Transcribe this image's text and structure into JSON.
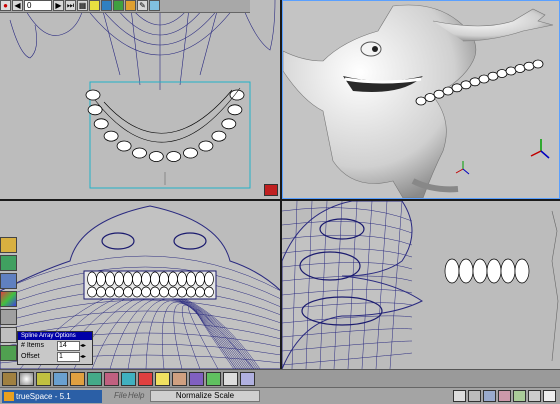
{
  "app": {
    "name": "trueSpace - 5.1",
    "menu_file": "File",
    "menu_help": "Help",
    "status_message": "Normalize Scale"
  },
  "toolbar_top": {
    "frame_value": "0"
  },
  "spline_panel": {
    "title": "Spline Array Options",
    "items_label": "# Items",
    "items_value": "14",
    "offset_label": "Offset",
    "offset_value": "1"
  },
  "icons": {
    "toolbar_top": [
      "record-icon",
      "play-reverse-icon",
      "frame-field",
      "play-forward-icon",
      "end-icon",
      "keyframe-icon",
      "axes-icon",
      "material-icon",
      "paint-icon",
      "object-icon",
      "pencil-icon",
      "perspective-icon"
    ],
    "tool_column": [
      "folder-icon",
      "move-icon",
      "spline-icon",
      "color-icon",
      "sweep-icon",
      "lathe-icon",
      "array-icon"
    ],
    "bottom_tools": [
      "camera-icon",
      "sphere-icon",
      "cone-icon",
      "cylinder-icon",
      "cube-icon",
      "plane-icon",
      "torus-icon",
      "material-icon",
      "paint-icon",
      "light-icon",
      "face-icon",
      "render-icon",
      "deform-icon",
      "text-icon",
      "script-icon"
    ],
    "status_right": [
      "arrow-icon",
      "pan-icon",
      "rotate-icon",
      "zoom-icon",
      "view-icon",
      "scale-icon",
      "undo-icon"
    ]
  },
  "colors": {
    "wireframe": "#1a1a6e",
    "selection": "#5aa0ff",
    "teeth": "#ffffff",
    "title_bar": "#0000a8"
  }
}
